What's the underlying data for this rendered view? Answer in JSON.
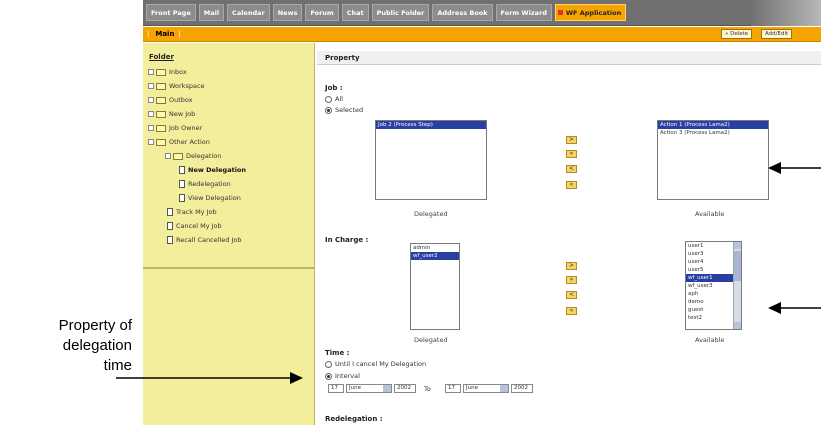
{
  "top_tabs": [
    "Front Page",
    "Mail",
    "Calendar",
    "News",
    "Forum",
    "Chat",
    "Public Folder",
    "Address Book",
    "Form Wizard",
    "WF Application"
  ],
  "active_tab": "WF Application",
  "subnav": {
    "main_label": "Main",
    "btn1": "« Delete",
    "btn2": "Add/Edit"
  },
  "sidebar": {
    "header": "Folder",
    "items": [
      "Inbox",
      "Workspace",
      "Outbox",
      "New Job",
      "Job Owner",
      "Other Action",
      "Delegation",
      "New Delegation",
      "Redelegation",
      "View Delegation",
      "Track My Job",
      "Cancel My Job",
      "Recall Cancelled Job"
    ]
  },
  "property": {
    "title": "Property",
    "job_label": "Job :",
    "job_all": "All",
    "job_selected": "Selected",
    "job_delegated_items": [
      "Job 2 (Process Step)"
    ],
    "job_available_items": [
      "Action 1 (Process Lama2)",
      "Action 3 (Process Lama2)"
    ],
    "delegated_label": "Delegated",
    "available_label": "Available",
    "arrow_btns": [
      ">",
      "»",
      "<",
      "«"
    ],
    "incharge_label": "In Charge :",
    "incharge_delegated_items": [
      "admin",
      "wf_user2"
    ],
    "incharge_available_items": [
      "user1",
      "user3",
      "user4",
      "user5",
      "wf_user1",
      "wf_user3",
      "aph",
      "demo",
      "guest",
      "test2"
    ],
    "time_label": "Time :",
    "time_until": "Until I cancel My Delegation",
    "time_interval": "Interval",
    "from_day": "17",
    "from_month": "June",
    "from_year": "2002",
    "to_label": "To",
    "to_day": "17",
    "to_month": "June",
    "to_year": "2002",
    "redelegation_label": "Redelegation :"
  },
  "annotation": {
    "line1": "Property of",
    "line2": "delegation",
    "line3": "time"
  }
}
